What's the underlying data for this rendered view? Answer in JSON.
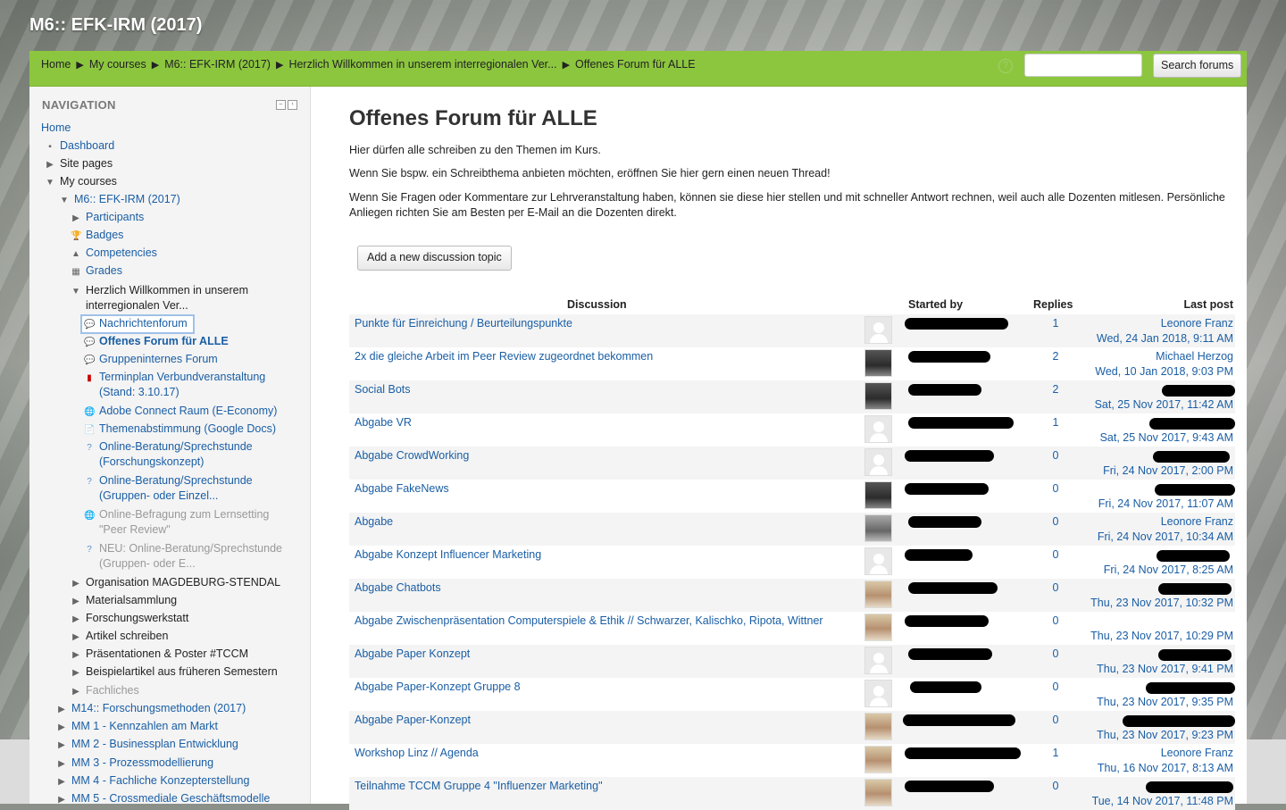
{
  "site": {
    "title": "M6:: EFK-IRM (2017)"
  },
  "breadcrumb": [
    "Home",
    "My courses",
    "M6:: EFK-IRM (2017)",
    "Herzlich Willkommen in unserem interregionalen Ver...",
    "Offenes Forum für ALLE"
  ],
  "header": {
    "help": "?",
    "search_value": "",
    "search_button": "Search forums"
  },
  "navigation": {
    "heading": "NAVIGATION",
    "home": "Home",
    "dashboard": "Dashboard",
    "site_pages": "Site pages",
    "my_courses": "My courses",
    "course": "M6:: EFK-IRM (2017)",
    "participants": "Participants",
    "badges": "Badges",
    "competencies": "Competencies",
    "grades": "Grades",
    "section_line1": "Herzlich Willkommen in unserem",
    "section_line2": "interregionalen Ver...",
    "activities": [
      {
        "l1": "Nachrichtenforum",
        "l2": ""
      },
      {
        "l1": "Offenes Forum für ALLE",
        "l2": ""
      },
      {
        "l1": "Gruppeninternes Forum",
        "l2": ""
      },
      {
        "l1": "Terminplan Verbundveranstaltung",
        "l2": "(Stand: 3.10.17)"
      },
      {
        "l1": "Adobe Connect Raum (E-Economy)",
        "l2": ""
      },
      {
        "l1": "Themenabstimmung (Google Docs)",
        "l2": ""
      },
      {
        "l1": "Online-Beratung/Sprechstunde",
        "l2": "(Forschungskonzept)"
      },
      {
        "l1": "Online-Beratung/Sprechstunde",
        "l2": "(Gruppen- oder Einzel..."
      },
      {
        "l1": "Online-Befragung zum Lernsetting",
        "l2": "\"Peer Review\""
      },
      {
        "l1": "NEU: Online-Beratung/Sprechstunde",
        "l2": "(Gruppen- oder E..."
      }
    ],
    "sections": [
      "Organisation MAGDEBURG-STENDAL",
      "Materialsammlung",
      "Forschungswerkstatt",
      "Artikel schreiben",
      "Präsentationen & Poster #TCCM",
      "Beispielartikel aus früheren Semestern",
      "Fachliches"
    ],
    "other_courses": [
      "M14:: Forschungsmethoden (2017)",
      "MM 1 - Kennzahlen am Markt",
      "MM 2 - Businessplan Entwicklung",
      "MM 3 - Prozessmodellierung",
      "MM 4 - Fachliche Konzepterstellung",
      "MM 5 - Crossmediale Geschäftsmodelle"
    ]
  },
  "forum": {
    "title": "Offenes Forum für ALLE",
    "intro": [
      "Hier dürfen alle schreiben zu den Themen im Kurs.",
      "Wenn Sie bspw. ein Schreibthema anbieten möchten, eröffnen Sie hier gern einen neuen Thread!",
      "Wenn Sie Fragen oder Kommentare zur Lehrveranstaltung haben, können sie diese hier stellen und mit schneller Antwort rechnen, weil auch alle Dozenten mitlesen. Persönliche",
      "Anliegen richten Sie am Besten per E-Mail an die Dozenten direkt."
    ],
    "add_button": "Add a new discussion topic",
    "columns": {
      "discussion": "Discussion",
      "started_by": "Started by",
      "replies": "Replies",
      "last_post": "Last post"
    },
    "topics": [
      {
        "title": "Punkte für Einreichung / Beurteilungspunkte",
        "replies": "1",
        "last_by": "Leonore Franz",
        "last_date": "Wed, 24 Jan 2018, 9:11 AM"
      },
      {
        "title": "2x die gleiche Arbeit im Peer Review zugeordnet bekommen",
        "replies": "2",
        "last_by": "Michael Herzog",
        "last_date": "Wed, 10 Jan 2018, 9:03 PM"
      },
      {
        "title": "Social Bots",
        "replies": "2",
        "last_by": "",
        "last_date": "Sat, 25 Nov 2017, 11:42 AM"
      },
      {
        "title": "Abgabe VR",
        "replies": "1",
        "last_by": "",
        "last_date": "Sat, 25 Nov 2017, 9:43 AM"
      },
      {
        "title": "Abgabe CrowdWorking",
        "replies": "0",
        "last_by": "",
        "last_date": "Fri, 24 Nov 2017, 2:00 PM"
      },
      {
        "title": "Abgabe FakeNews",
        "replies": "0",
        "last_by": "",
        "last_date": "Fri, 24 Nov 2017, 11:07 AM"
      },
      {
        "title": "Abgabe",
        "replies": "0",
        "last_by": "Leonore Franz",
        "last_date": "Fri, 24 Nov 2017, 10:34 AM"
      },
      {
        "title": "Abgabe Konzept Influencer Marketing",
        "replies": "0",
        "last_by": "",
        "last_date": "Fri, 24 Nov 2017, 8:25 AM"
      },
      {
        "title": "Abgabe Chatbots",
        "replies": "0",
        "last_by": "",
        "last_date": "Thu, 23 Nov 2017, 10:32 PM"
      },
      {
        "title": "Abgabe Zwischenpräsentation Computerspiele & Ethik // Schwarzer, Kalischko, Ripota, Wittner",
        "replies": "0",
        "last_by": "",
        "last_date": "Thu, 23 Nov 2017, 10:29 PM"
      },
      {
        "title": "Abgabe Paper Konzept",
        "replies": "0",
        "last_by": "",
        "last_date": "Thu, 23 Nov 2017, 9:41 PM"
      },
      {
        "title": "Abgabe Paper-Konzept Gruppe 8",
        "replies": "0",
        "last_by": "",
        "last_date": "Thu, 23 Nov 2017, 9:35 PM"
      },
      {
        "title": "Abgabe Paper-Konzept",
        "replies": "0",
        "last_by": "",
        "last_date": "Thu, 23 Nov 2017, 9:23 PM"
      },
      {
        "title": "Workshop Linz // Agenda",
        "replies": "1",
        "last_by": "Leonore Franz",
        "last_date": "Thu, 16 Nov 2017, 8:13 AM"
      },
      {
        "title": "Teilnahme TCCM Gruppe 4 \"Influenzer Marketing\"",
        "replies": "0",
        "last_by": "",
        "last_date": "Tue, 14 Nov 2017, 11:48 PM"
      }
    ]
  }
}
